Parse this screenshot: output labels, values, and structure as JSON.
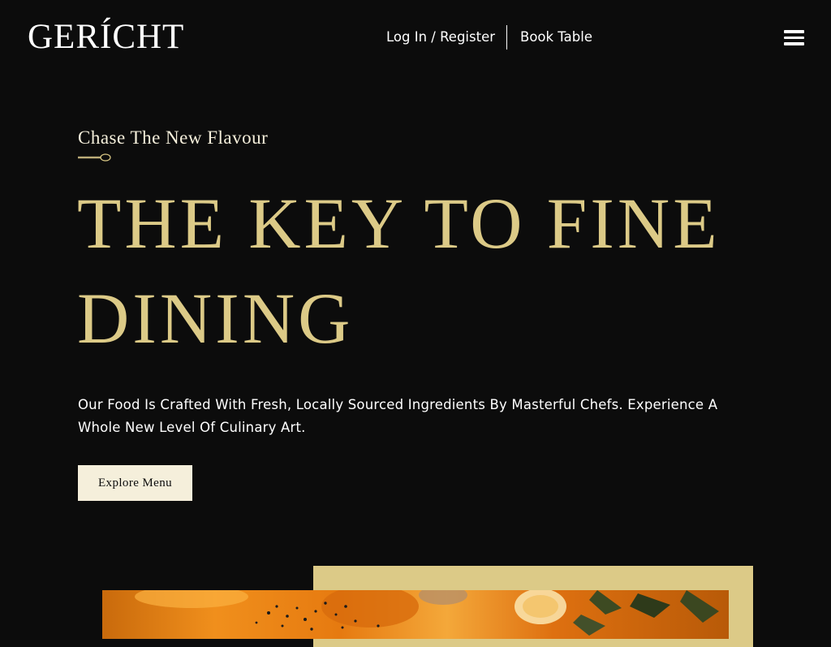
{
  "brand": {
    "logo": "GERÍCHT"
  },
  "nav": {
    "login_label": "Log In / Register",
    "book_label": "Book Table",
    "menu_icon": "hamburger-menu-icon"
  },
  "hero": {
    "subtitle": "Chase The New Flavour",
    "subtitle_icon": "spoon-icon",
    "headline": "THE KEY TO FINE DINING",
    "description": "Our Food Is Crafted With Fresh, Locally Sourced Ingredients By Masterful Chefs. Experience A Whole New Level Of Culinary Art.",
    "cta_label": "Explore Menu"
  },
  "colors": {
    "background": "#0c0c0c",
    "gold": "#dcca87",
    "cream": "#f5efdb",
    "white": "#ffffff"
  }
}
